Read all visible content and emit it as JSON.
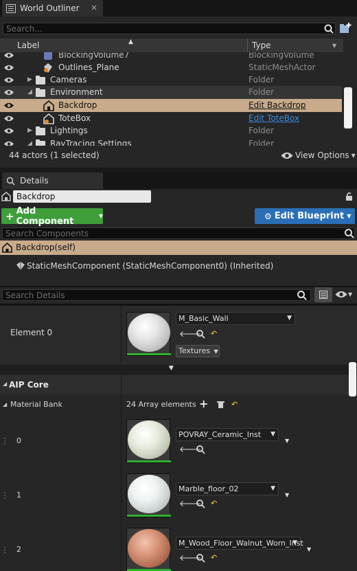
{
  "outliner": {
    "tab_title": "World Outliner",
    "close": "×",
    "search_placeholder": "Search...",
    "col_label": "Label",
    "col_type": "Type",
    "rows": [
      {
        "label": "BlockingVolume7",
        "type": "BlockingVolume"
      },
      {
        "label": "Outlines_Plane",
        "type": "StaticMeshActor"
      },
      {
        "label": "Cameras",
        "type": "Folder"
      },
      {
        "label": "Environment",
        "type": "Folder"
      },
      {
        "label": "Backdrop",
        "type": "Edit Backdrop"
      },
      {
        "label": "ToteBox",
        "type": "Edit ToteBox"
      },
      {
        "label": "Lightings",
        "type": "Folder"
      },
      {
        "label": "RayTracing Settings",
        "type": "Folder"
      }
    ],
    "status": "44 actors (1 selected)",
    "view_options": "View Options"
  },
  "details": {
    "tab_title": "Details",
    "actor_name": "Backdrop",
    "add_component": "Add Component",
    "edit_blueprint": "Edit Blueprint",
    "search_components_placeholder": "Search Components",
    "self_item": "Backdrop(self)",
    "component_item": "StaticMeshComponent (StaticMeshComponent0) (Inherited)",
    "search_details_placeholder": "Search Details",
    "element0_label": "Element 0",
    "element0_material": "M_Basic_Wall",
    "textures_label": "Textures",
    "section_title": "AIP Core",
    "material_bank_label": "Material Bank",
    "array_count": "24 Array elements",
    "items": [
      {
        "index": "0",
        "material": "POVRAY_Ceramic_Inst"
      },
      {
        "index": "1",
        "material": "Marble_floor_02"
      },
      {
        "index": "2",
        "material": "M_Wood_Floor_Walnut_Worn_Inst"
      }
    ]
  },
  "colors": {
    "add_component_green": "#3e9e3a",
    "edit_blueprint_blue": "#2a6fb5",
    "selection_tan": "#c7ab8b",
    "link_blue": "#3a8ad8"
  }
}
